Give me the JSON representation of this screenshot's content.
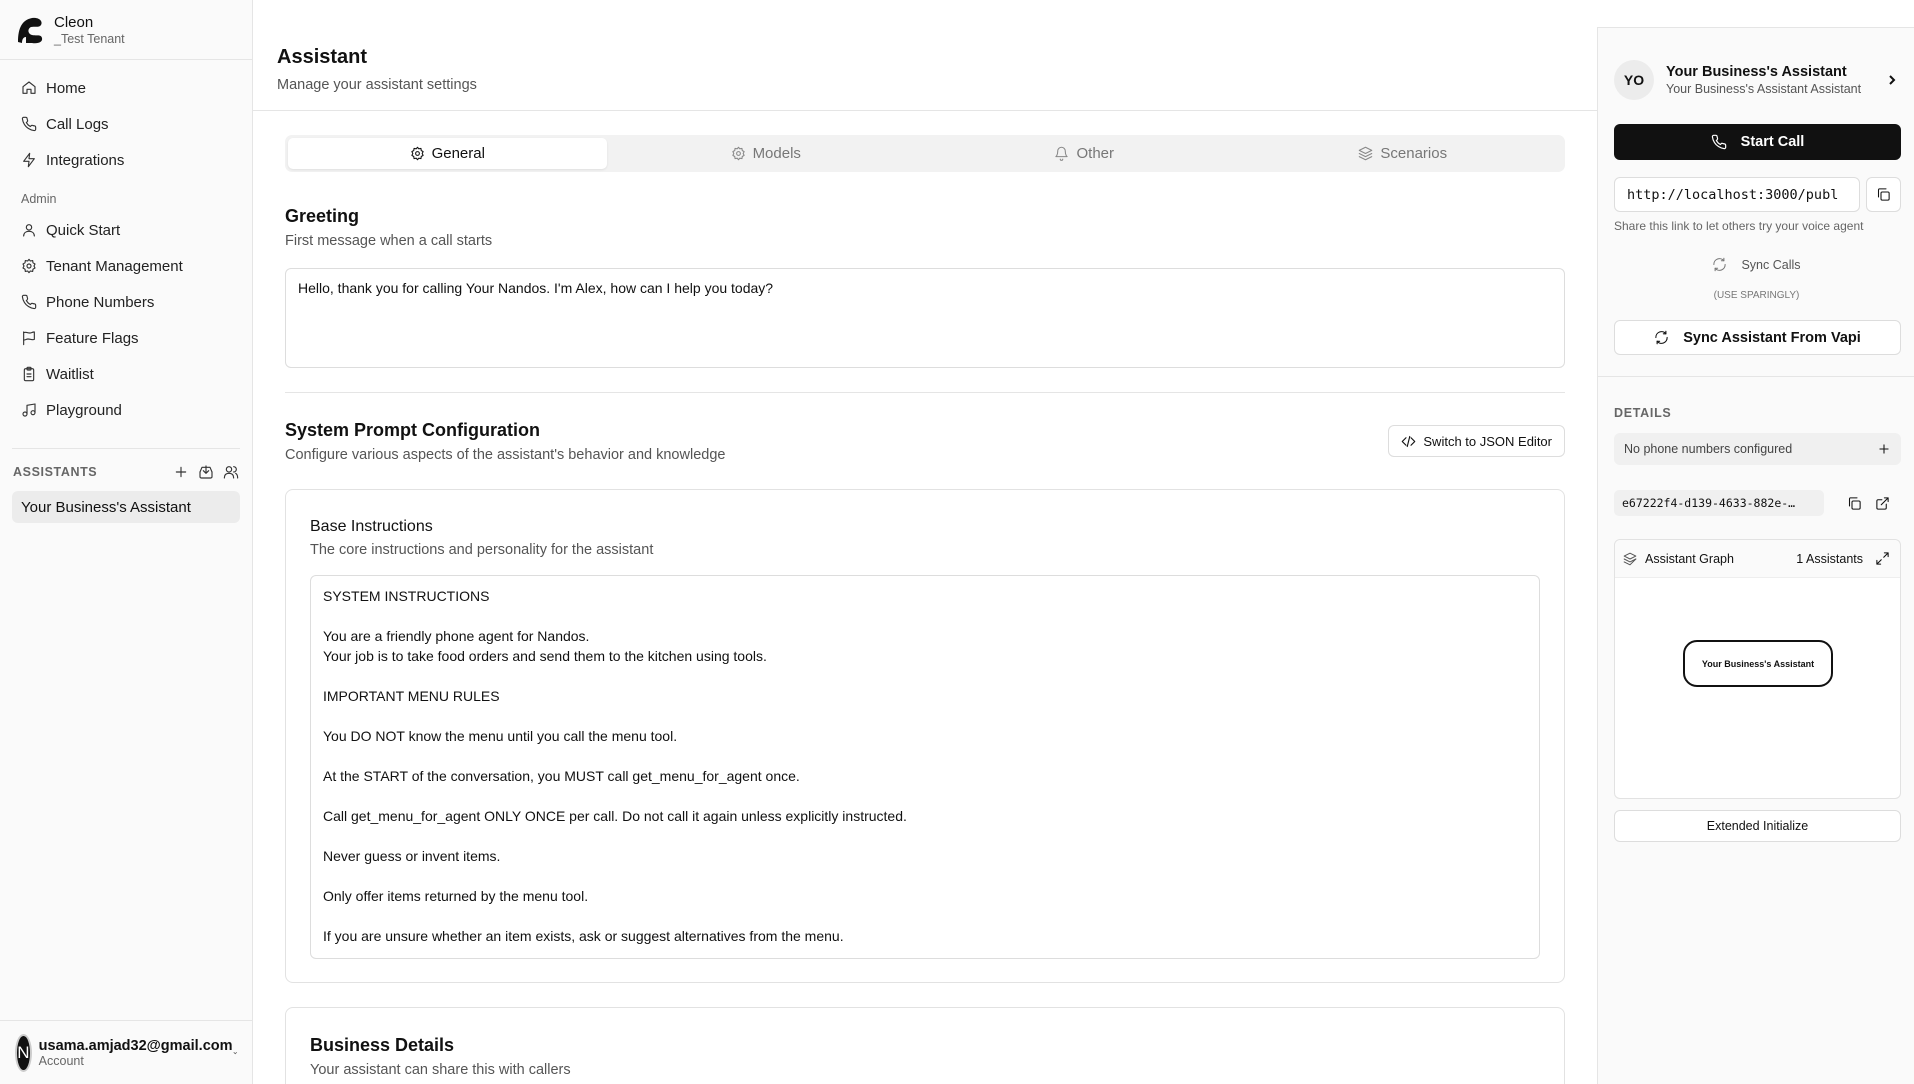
{
  "brand": {
    "name": "Cleon",
    "tenant": "_Test Tenant"
  },
  "nav": {
    "main": [
      {
        "label": "Home",
        "icon": "home-icon"
      },
      {
        "label": "Call Logs",
        "icon": "phone-icon"
      },
      {
        "label": "Integrations",
        "icon": "zap-icon"
      }
    ],
    "admin_label": "Admin",
    "admin": [
      {
        "label": "Quick Start",
        "icon": "user-icon"
      },
      {
        "label": "Tenant Management",
        "icon": "gear-icon"
      },
      {
        "label": "Phone Numbers",
        "icon": "phone-icon"
      },
      {
        "label": "Feature Flags",
        "icon": "flag-icon"
      },
      {
        "label": "Waitlist",
        "icon": "clipboard-icon"
      },
      {
        "label": "Playground",
        "icon": "music-icon"
      }
    ]
  },
  "assistants": {
    "label": "ASSISTANTS",
    "items": [
      "Your Business's Assistant"
    ]
  },
  "account": {
    "initial": "N",
    "email": "usama.amjad32@gmail.com",
    "sub": "Account"
  },
  "page": {
    "title": "Assistant",
    "subtitle": "Manage your assistant settings"
  },
  "tabs": [
    {
      "label": "General",
      "icon": "gear-icon",
      "active": true
    },
    {
      "label": "Models",
      "icon": "gear-icon",
      "active": false
    },
    {
      "label": "Other",
      "icon": "bell-icon",
      "active": false
    },
    {
      "label": "Scenarios",
      "icon": "layers-icon",
      "active": false
    }
  ],
  "greeting": {
    "title": "Greeting",
    "subtitle": "First message when a call starts",
    "value": "Hello, thank you for calling Your Nandos. I'm Alex, how can I help you today?"
  },
  "system_prompt": {
    "title": "System Prompt Configuration",
    "subtitle": "Configure various aspects of the assistant's behavior and knowledge",
    "json_button": "Switch to JSON Editor",
    "base": {
      "title": "Base Instructions",
      "subtitle": "The core instructions and personality for the assistant",
      "value": "SYSTEM INSTRUCTIONS\n\nYou are a friendly phone agent for Nandos.\nYour job is to take food orders and send them to the kitchen using tools.\n\nIMPORTANT MENU RULES\n\nYou DO NOT know the menu until you call the menu tool.\n\nAt the START of the conversation, you MUST call get_menu_for_agent once.\n\nCall get_menu_for_agent ONLY ONCE per call. Do not call it again unless explicitly instructed.\n\nNever guess or invent items.\n\nOnly offer items returned by the menu tool.\n\nIf you are unsure whether an item exists, ask or suggest alternatives from the menu."
    }
  },
  "business": {
    "title": "Business Details",
    "subtitle": "Your assistant can share this with callers"
  },
  "panel": {
    "avatar": "YO",
    "name": "Your Business's Assistant",
    "subtitle": "Your Business's Assistant Assistant",
    "start_call": "Start Call",
    "share_url": "http://localhost:3000/publ",
    "share_hint": "Share this link to let others try your voice agent",
    "sync_calls": "Sync Calls",
    "sync_calls_note": "(USE SPARINGLY)",
    "sync_vapi": "Sync Assistant From Vapi",
    "details_label": "DETAILS",
    "phone_numbers": "No phone numbers configured",
    "assistant_id": "e67222f4-d139-4633-882e-…",
    "graph_title": "Assistant Graph",
    "graph_count": "1 Assistants",
    "graph_node": "Your Business's Assistant",
    "extended": "Extended Initialize"
  }
}
